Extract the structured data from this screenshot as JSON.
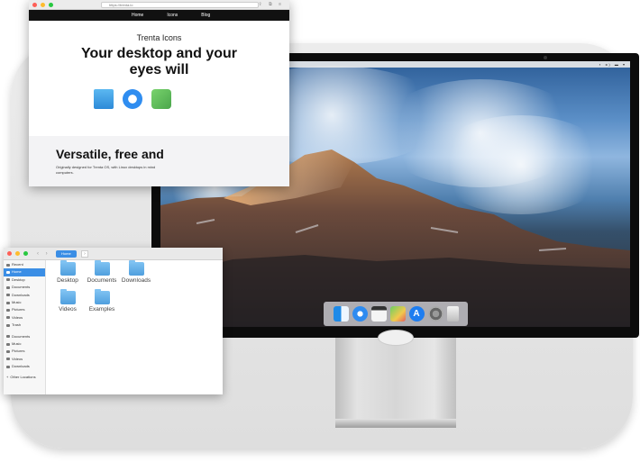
{
  "browser": {
    "url": "https://trenta.io",
    "nav": [
      "Home",
      "Icons",
      "Blog"
    ],
    "apple_glyph": "",
    "brand": "Trenta Icons",
    "headline_line1": "Your desktop and your",
    "headline_line2": "eyes will",
    "section_title": "Versatile, free and",
    "section_text": "Originally designed for Trenta OS, with Linux desktops in mind",
    "section_text2": "computers.",
    "icons": [
      "folder-icon",
      "safari-icon",
      "maps-icon"
    ]
  },
  "files": {
    "path_label": "Home",
    "sidebar": [
      {
        "label": "Recent",
        "active": false
      },
      {
        "label": "Home",
        "active": true
      },
      {
        "label": "Desktop",
        "active": false
      },
      {
        "label": "Documents",
        "active": false
      },
      {
        "label": "Downloads",
        "active": false
      },
      {
        "label": "Music",
        "active": false
      },
      {
        "label": "Pictures",
        "active": false
      },
      {
        "label": "Videos",
        "active": false
      },
      {
        "label": "Trash",
        "active": false
      }
    ],
    "sidebar2": [
      "Documents",
      "Music",
      "Pictures",
      "Videos",
      "Downloads"
    ],
    "other_locations": "Other Locations",
    "folders": [
      "Desktop",
      "Documents",
      "Downloads",
      "Videos",
      "Examples"
    ]
  },
  "desktop": {
    "trash_label": "Trash",
    "dock": [
      "finder-icon",
      "safari-icon",
      "notes-icon",
      "maps-icon",
      "app-store-icon",
      "settings-icon",
      "trash-icon"
    ],
    "app_store_glyph": "A"
  },
  "colors": {
    "accent": "#3b8ee5",
    "traffic_red": "#fe5f57",
    "traffic_yellow": "#febc2e",
    "traffic_green": "#28c840"
  }
}
